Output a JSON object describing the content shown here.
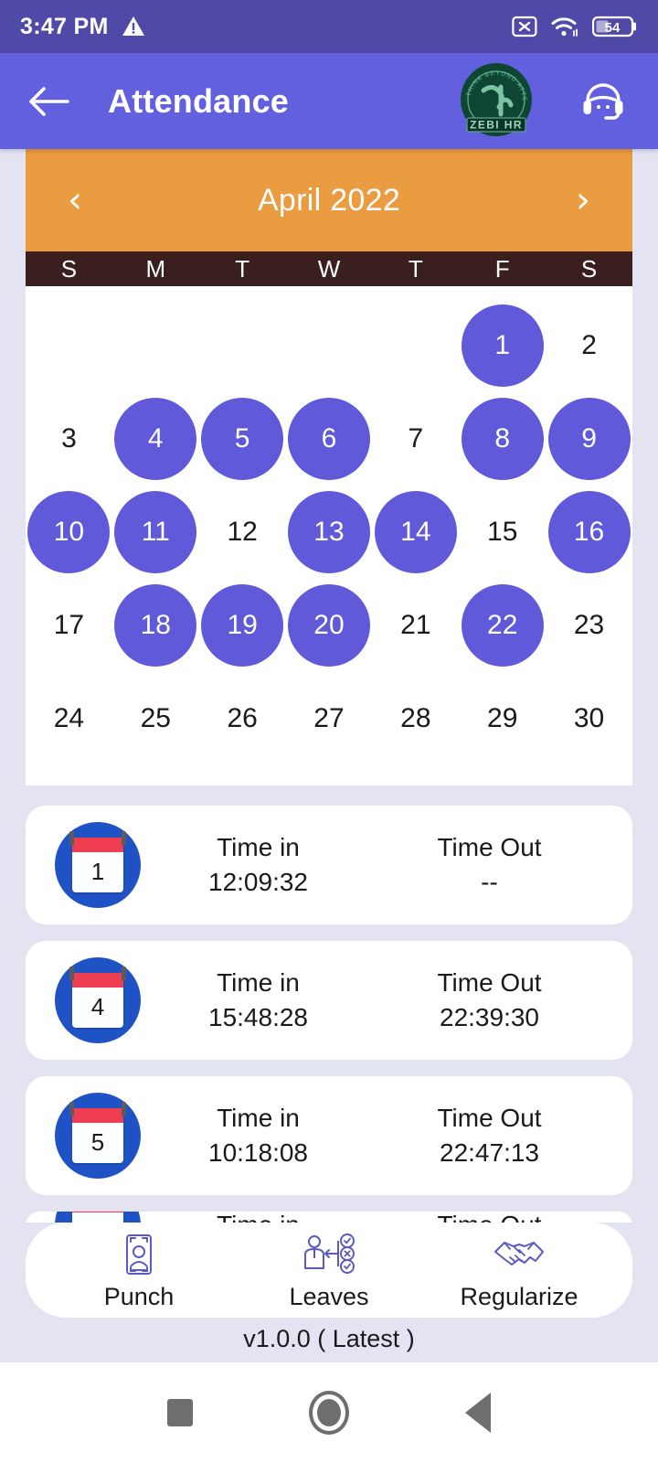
{
  "statusbar": {
    "time": "3:47 PM",
    "warning_icon": "warning-triangle-icon",
    "nosim_icon": "no-sim-icon",
    "wifi_icon": "wifi-icon",
    "battery_level": "54",
    "battery_icon": "battery-icon"
  },
  "appbar": {
    "back_icon": "back-arrow-icon",
    "title": "Attendance",
    "logo_name": "ZEBI HR",
    "logo_tagline": "THINK BEYOND ATTENDANCE",
    "support_icon": "headset-support-icon",
    "background_color": "#6360e0"
  },
  "calendar": {
    "prev_label": "‹",
    "next_label": "›",
    "title": "April 2022",
    "header_color": "#eb9b40",
    "dow_color": "#3b1f1f",
    "marked_color": "#6059d9",
    "day_names": [
      "S",
      "M",
      "T",
      "W",
      "T",
      "F",
      "S"
    ],
    "leading_blanks": 5,
    "days": [
      {
        "n": "1",
        "marked": true
      },
      {
        "n": "2",
        "marked": false
      },
      {
        "n": "3",
        "marked": false
      },
      {
        "n": "4",
        "marked": true
      },
      {
        "n": "5",
        "marked": true
      },
      {
        "n": "6",
        "marked": true
      },
      {
        "n": "7",
        "marked": false
      },
      {
        "n": "8",
        "marked": true
      },
      {
        "n": "9",
        "marked": true
      },
      {
        "n": "10",
        "marked": true
      },
      {
        "n": "11",
        "marked": true
      },
      {
        "n": "12",
        "marked": false
      },
      {
        "n": "13",
        "marked": true
      },
      {
        "n": "14",
        "marked": true
      },
      {
        "n": "15",
        "marked": false
      },
      {
        "n": "16",
        "marked": true
      },
      {
        "n": "17",
        "marked": false
      },
      {
        "n": "18",
        "marked": true
      },
      {
        "n": "19",
        "marked": true
      },
      {
        "n": "20",
        "marked": true
      },
      {
        "n": "21",
        "marked": false
      },
      {
        "n": "22",
        "marked": true
      },
      {
        "n": "23",
        "marked": false
      },
      {
        "n": "24",
        "marked": false
      },
      {
        "n": "25",
        "marked": false
      },
      {
        "n": "26",
        "marked": false
      },
      {
        "n": "27",
        "marked": false
      },
      {
        "n": "28",
        "marked": false
      },
      {
        "n": "29",
        "marked": false
      },
      {
        "n": "30",
        "marked": false
      }
    ]
  },
  "attendance": {
    "time_in_label": "Time in",
    "time_out_label": "Time Out",
    "records": [
      {
        "day": "1",
        "time_in": "12:09:32",
        "time_out": "--"
      },
      {
        "day": "4",
        "time_in": "15:48:28",
        "time_out": "22:39:30"
      },
      {
        "day": "5",
        "time_in": "10:18:08",
        "time_out": "22:47:13"
      }
    ]
  },
  "actions": [
    {
      "label": "Punch",
      "icon": "punch-face-scan-icon"
    },
    {
      "label": "Leaves",
      "icon": "leaves-approval-icon"
    },
    {
      "label": "Regularize",
      "icon": "handshake-icon"
    }
  ],
  "footer": {
    "version": "v1.0.0 ( Latest )"
  },
  "sysnav": {
    "recents_icon": "recents-square-icon",
    "home_icon": "home-circle-icon",
    "back_icon": "back-triangle-icon"
  }
}
